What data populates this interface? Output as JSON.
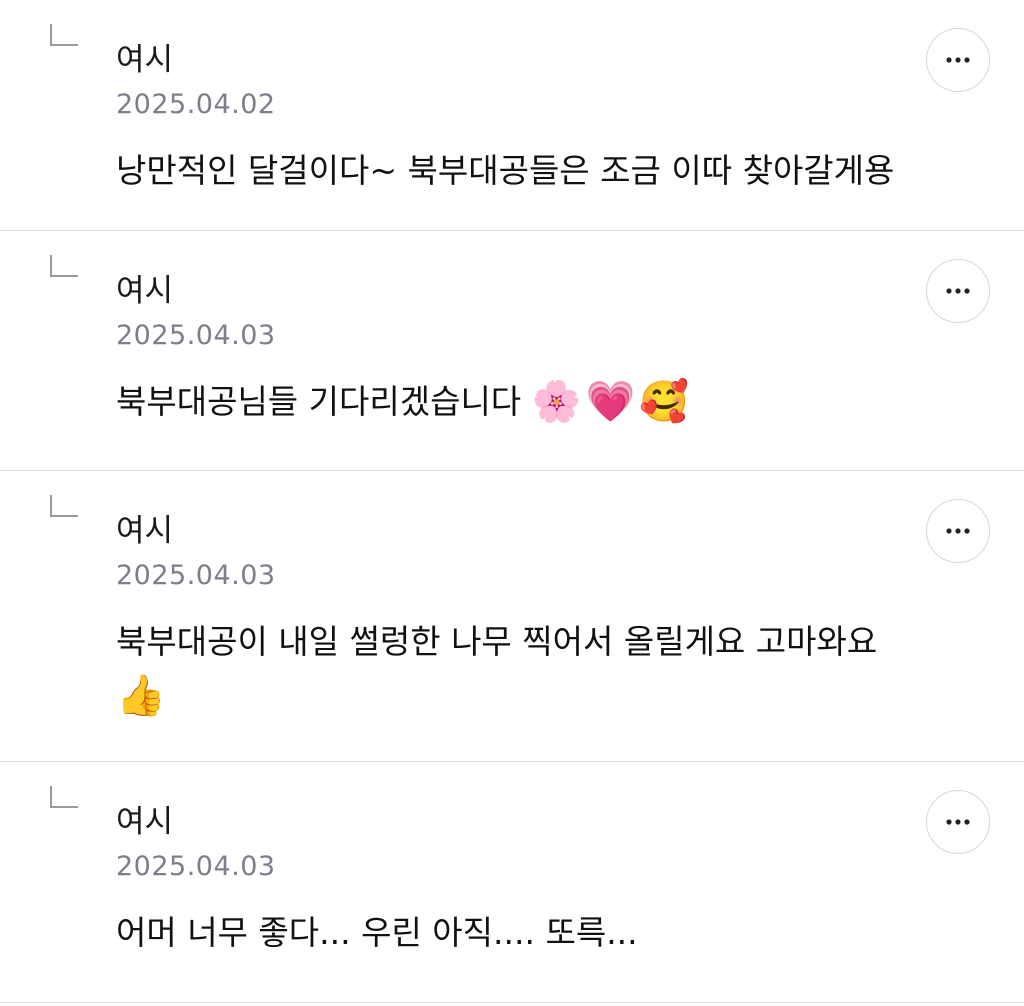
{
  "comments": [
    {
      "author": "여시",
      "date": "2025.04.02",
      "text": "낭만적인 달걸이다~ 북부대공들은 조금 이따 찾아갈게용",
      "emojis": []
    },
    {
      "author": "여시",
      "date": "2025.04.03",
      "text": "북부대공님들 기다리겠습니다",
      "emojis": [
        "🌸",
        "💗",
        "🥰"
      ]
    },
    {
      "author": "여시",
      "date": "2025.04.03",
      "text": "북부대공이 내일 썰렁한 나무 찍어서 올릴게요 고마와요",
      "emojis": [
        "👍"
      ]
    },
    {
      "author": "여시",
      "date": "2025.04.03",
      "text": "어머 너무 좋다... 우린 아직.... 또륵...",
      "emojis": []
    }
  ],
  "icons": {
    "reply": "reply-corner-icon",
    "more": "more-horizontal-icon",
    "cherry_blossom": "cherry-blossom-icon",
    "growing_heart": "growing-heart-icon",
    "smiling_face_hearts": "smiling-face-with-hearts-icon",
    "thumbs_up": "thumbs-up-icon"
  },
  "colors": {
    "text": "#111111",
    "meta": "#7c7f8a",
    "divider": "#e2e2e2",
    "button_border": "#d8d8d8"
  }
}
